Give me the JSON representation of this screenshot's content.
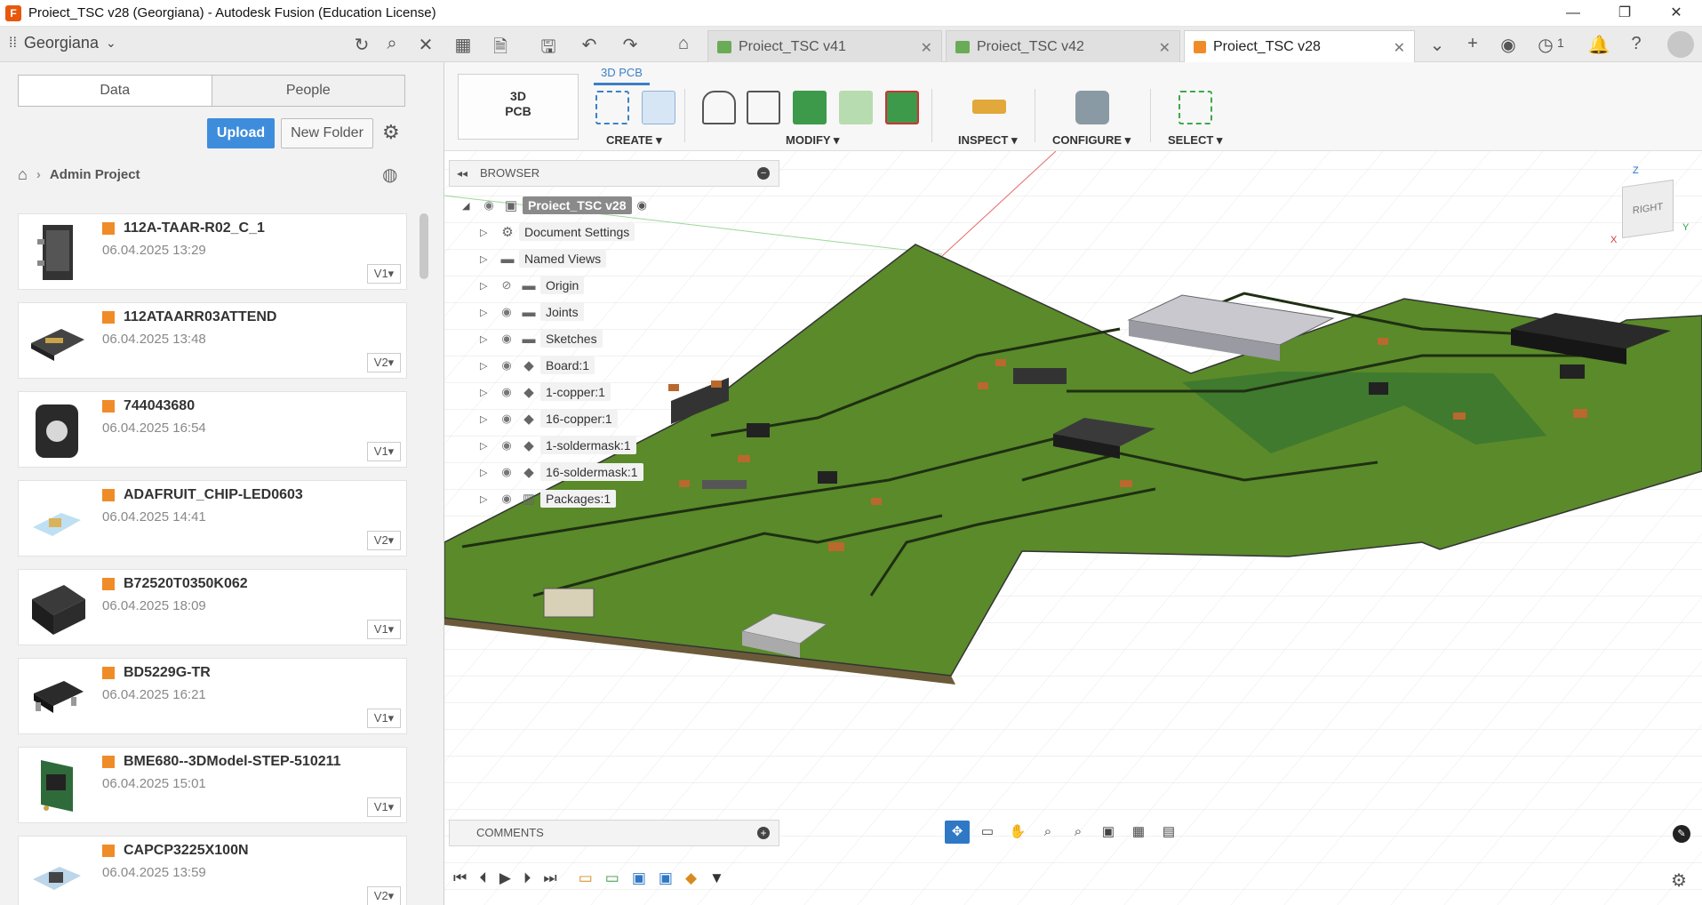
{
  "window": {
    "title": "Proiect_TSC v28 (Georgiana) - Autodesk Fusion (Education License)",
    "app_icon": "F"
  },
  "topbar": {
    "user": "Georgiana",
    "notification_count": "1"
  },
  "tabs": [
    {
      "label": "Proiect_TSC v41",
      "active": false,
      "icon": "pcb-icon"
    },
    {
      "label": "Proiect_TSC v42",
      "active": false,
      "icon": "pcb-icon"
    },
    {
      "label": "Proiect_TSC v28",
      "active": true,
      "icon": "cube-icon"
    }
  ],
  "data_panel": {
    "seg_data": "Data",
    "seg_people": "People",
    "upload": "Upload",
    "new_folder": "New Folder",
    "breadcrumb": "Admin Project",
    "files": [
      {
        "name": "112A-TAAR-R02_C_1",
        "date": "06.04.2025 13:29",
        "version": "V1▾"
      },
      {
        "name": "112ATAARR03ATTEND",
        "date": "06.04.2025 13:48",
        "version": "V2▾"
      },
      {
        "name": "744043680",
        "date": "06.04.2025 16:54",
        "version": "V1▾"
      },
      {
        "name": "ADAFRUIT_CHIP-LED0603",
        "date": "06.04.2025 14:41",
        "version": "V2▾"
      },
      {
        "name": "B72520T0350K062",
        "date": "06.04.2025 18:09",
        "version": "V1▾"
      },
      {
        "name": "BD5229G-TR",
        "date": "06.04.2025 16:21",
        "version": "V1▾"
      },
      {
        "name": "BME680--3DModel-STEP-510211",
        "date": "06.04.2025 15:01",
        "version": "V1▾"
      },
      {
        "name": "CAPCP3225X100N",
        "date": "06.04.2025 13:59",
        "version": "V2▾"
      }
    ]
  },
  "ribbon": {
    "workspace_line1": "3D",
    "workspace_line2": "PCB",
    "active_tab": "3D PCB",
    "groups": [
      "CREATE ▾",
      "MODIFY ▾",
      "INSPECT ▾",
      "CONFIGURE ▾",
      "SELECT ▾"
    ]
  },
  "browser": {
    "title": "BROWSER",
    "root": "Proiect_TSC v28",
    "items": [
      "Document Settings",
      "Named Views",
      "Origin",
      "Joints",
      "Sketches",
      "Board:1",
      "1-copper:1",
      "16-copper:1",
      "1-soldermask:1",
      "16-soldermask:1",
      "Packages:1"
    ]
  },
  "comments": {
    "title": "COMMENTS"
  },
  "viewcube": {
    "face": "RIGHT",
    "z": "Z",
    "y": "Y",
    "x": "X"
  },
  "colors": {
    "accent": "#3e8ddd",
    "board": "#5a8a2a",
    "fusion_orange": "#f08c28"
  }
}
